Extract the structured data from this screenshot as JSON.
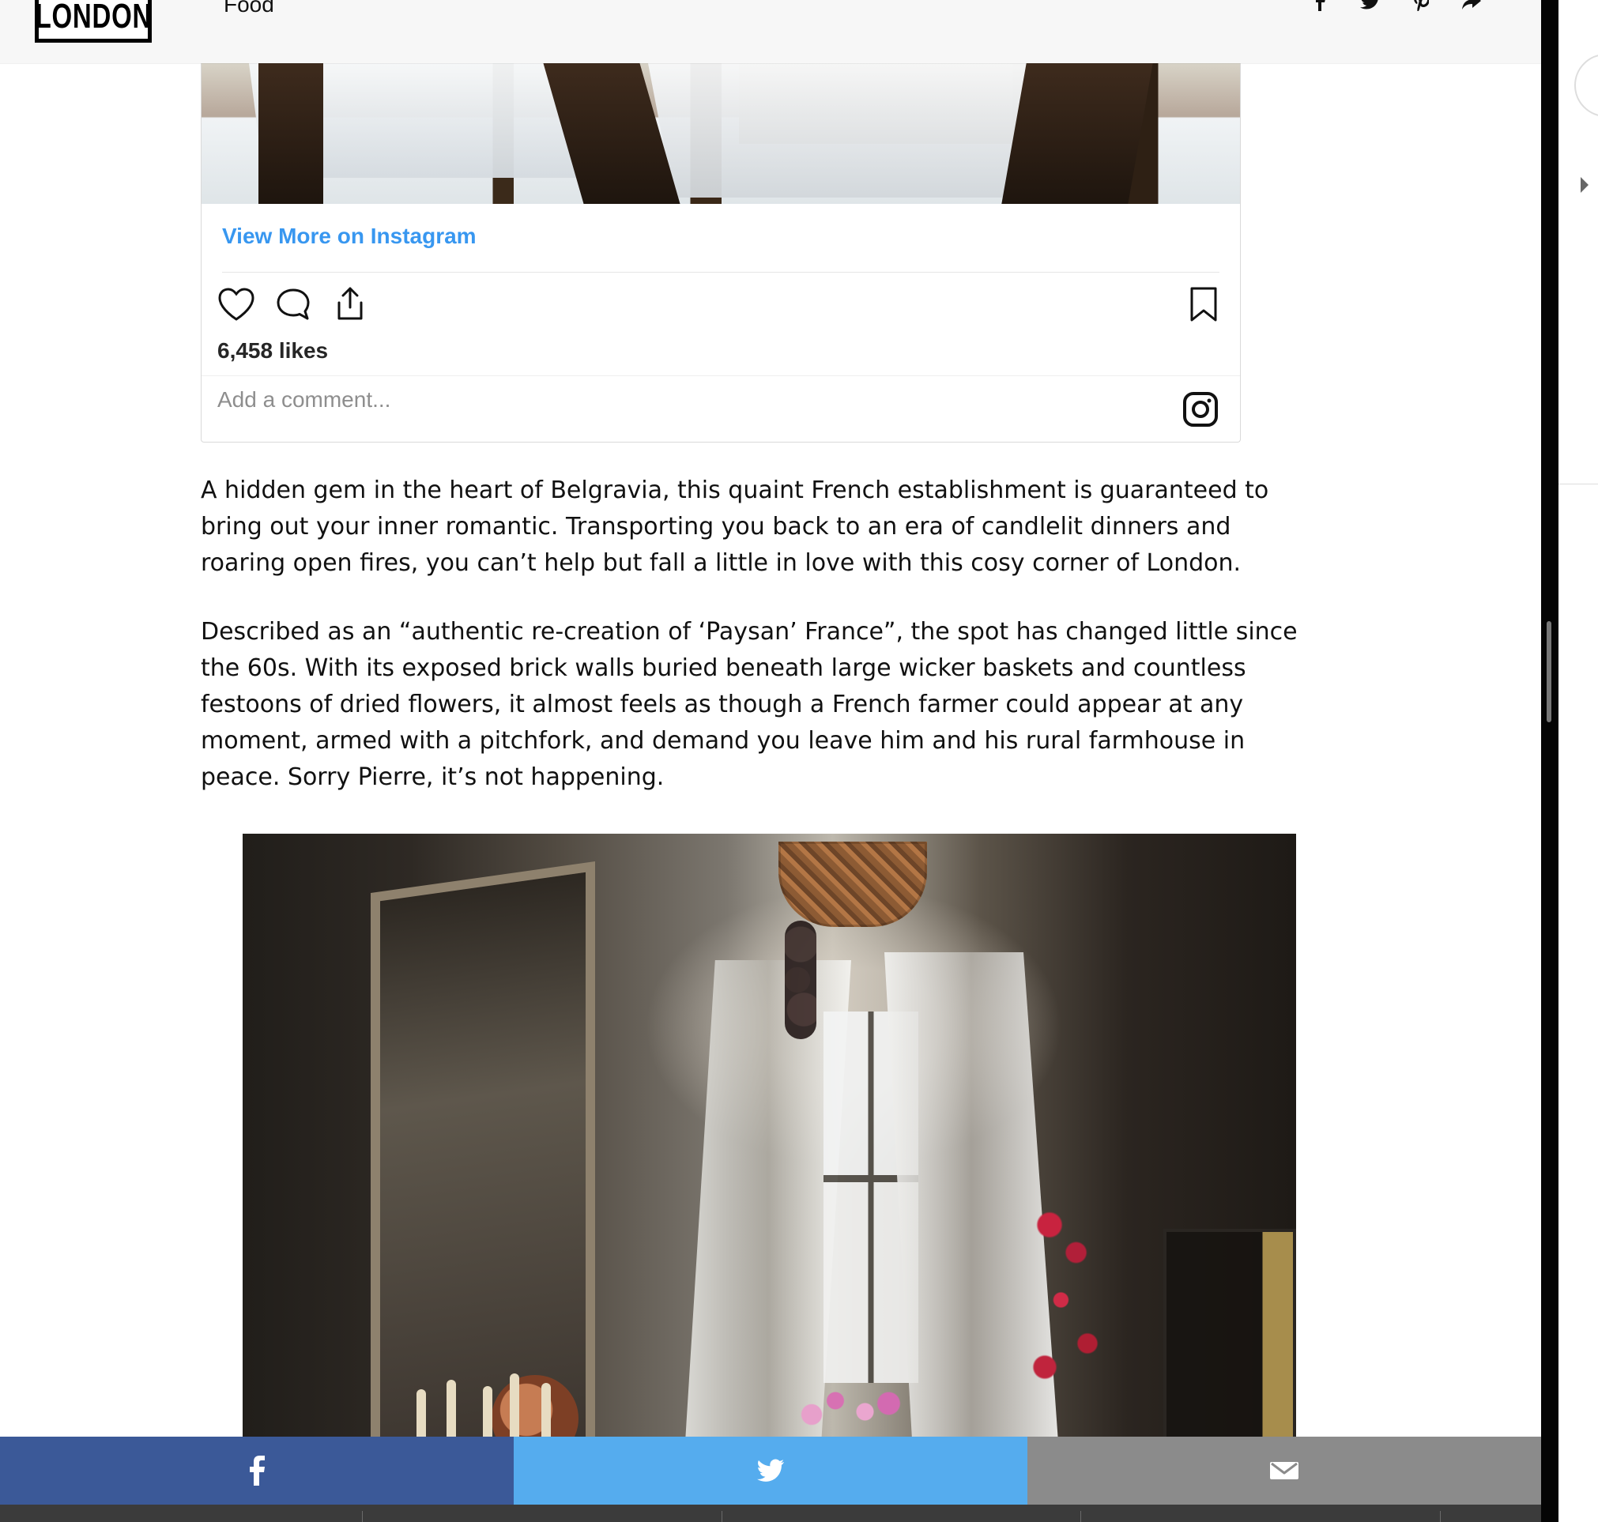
{
  "header": {
    "logo": "LONDON",
    "nav_item": "Food",
    "share_icons": [
      "facebook-icon",
      "twitter-icon",
      "pinterest-icon",
      "share-arrow-icon"
    ]
  },
  "instagram_embed": {
    "link_text": "View More on Instagram",
    "likes": "6,458 likes",
    "comment_placeholder": "Add a comment..."
  },
  "article": {
    "paragraph_1": "A hidden gem in the heart of Belgravia, this quaint French establishment is guaranteed to bring out your inner romantic. Transporting you back to an era of candlelit dinners and roaring open fires, you can’t help but fall a little in love with this cosy corner of London.",
    "paragraph_2": "Described as an “authentic re-creation of ‘Paysan’ France”, the spot has changed little since the 60s. With its exposed brick walls buried beneath large wicker baskets and countless festoons of dried flowers, it almost feels as though a French farmer could appear at any moment, armed with a pitchfork, and demand you leave him and his rural farmhouse in peace. Sorry Pierre, it’s not happening."
  },
  "share_bar": {
    "buttons": [
      "facebook-icon",
      "twitter-icon",
      "email-icon"
    ],
    "colors": {
      "facebook": "#3b5998",
      "twitter": "#55acee",
      "email": "#8b8b8b"
    }
  },
  "colors": {
    "instagram_link": "#3897f0",
    "text": "#111111"
  }
}
